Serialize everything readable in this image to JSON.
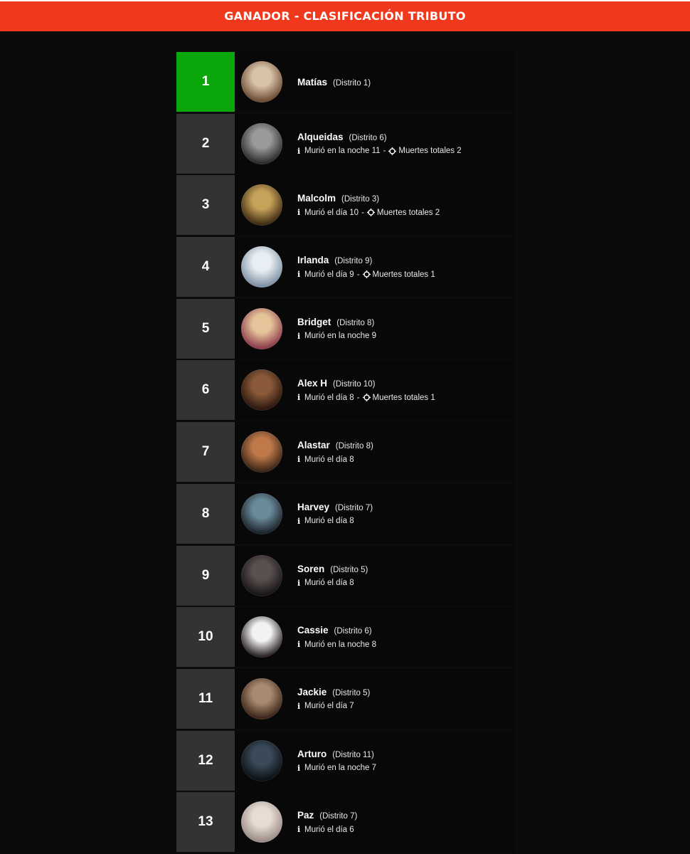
{
  "header": {
    "title": "GANADOR - CLASIFICACIÓN TRIBUTO",
    "color": "#f0391c"
  },
  "colors": {
    "winner": "#0aa70a",
    "rank_box": "#333333",
    "background": "#0b0b0b"
  },
  "tributes": [
    {
      "rank": "1",
      "name": "Matías",
      "district": "(Distrito 1)",
      "death": "",
      "kills": "",
      "avatar": [
        "#d8c3a8",
        "#6b4a32"
      ]
    },
    {
      "rank": "2",
      "name": "Alqueidas",
      "district": "(Distrito 6)",
      "death": "Murió en la noche 11",
      "kills": "Muertes totales 2",
      "avatar": [
        "#9a9a9a",
        "#2a2a2a"
      ]
    },
    {
      "rank": "3",
      "name": "Malcolm",
      "district": "(Distrito 3)",
      "death": "Murió el día 10",
      "kills": "Muertes totales 2",
      "avatar": [
        "#c7a25a",
        "#3d2a12"
      ]
    },
    {
      "rank": "4",
      "name": "Irlanda",
      "district": "(Distrito 9)",
      "death": "Murió el día 9",
      "kills": "Muertes totales 1",
      "avatar": [
        "#e8eef2",
        "#7d8fa3"
      ]
    },
    {
      "rank": "5",
      "name": "Bridget",
      "district": "(Distrito 8)",
      "death": "Murió en la noche 9",
      "kills": "",
      "avatar": [
        "#e6c49a",
        "#8a3a4a"
      ]
    },
    {
      "rank": "6",
      "name": "Alex H",
      "district": "(Distrito 10)",
      "death": "Murió el día 8",
      "kills": "Muertes totales 1",
      "avatar": [
        "#8a5a3a",
        "#2a160c"
      ]
    },
    {
      "rank": "7",
      "name": "Alastar",
      "district": "(Distrito 8)",
      "death": "Murió el día 8",
      "kills": "",
      "avatar": [
        "#c07a4a",
        "#3a2418"
      ]
    },
    {
      "rank": "8",
      "name": "Harvey",
      "district": "(Distrito 7)",
      "death": "Murió el día 8",
      "kills": "",
      "avatar": [
        "#6a8a9a",
        "#1a2228"
      ]
    },
    {
      "rank": "9",
      "name": "Soren",
      "district": "(Distrito 5)",
      "death": "Murió el día 8",
      "kills": "",
      "avatar": [
        "#5a5050",
        "#181414"
      ]
    },
    {
      "rank": "10",
      "name": "Cassie",
      "district": "(Distrito 6)",
      "death": "Murió en la noche 8",
      "kills": "",
      "avatar": [
        "#f2f2f2",
        "#2a2222"
      ]
    },
    {
      "rank": "11",
      "name": "Jackie",
      "district": "(Distrito 5)",
      "death": "Murió el día 7",
      "kills": "",
      "avatar": [
        "#a88a70",
        "#3a2418"
      ]
    },
    {
      "rank": "12",
      "name": "Arturo",
      "district": "(Distrito 11)",
      "death": "Murió en la noche 7",
      "kills": "",
      "avatar": [
        "#3a4a5a",
        "#0c1014"
      ]
    },
    {
      "rank": "13",
      "name": "Paz",
      "district": "(Distrito 7)",
      "death": "Murió el día 6",
      "kills": "",
      "avatar": [
        "#e8dcd4",
        "#9a8c84"
      ]
    }
  ]
}
